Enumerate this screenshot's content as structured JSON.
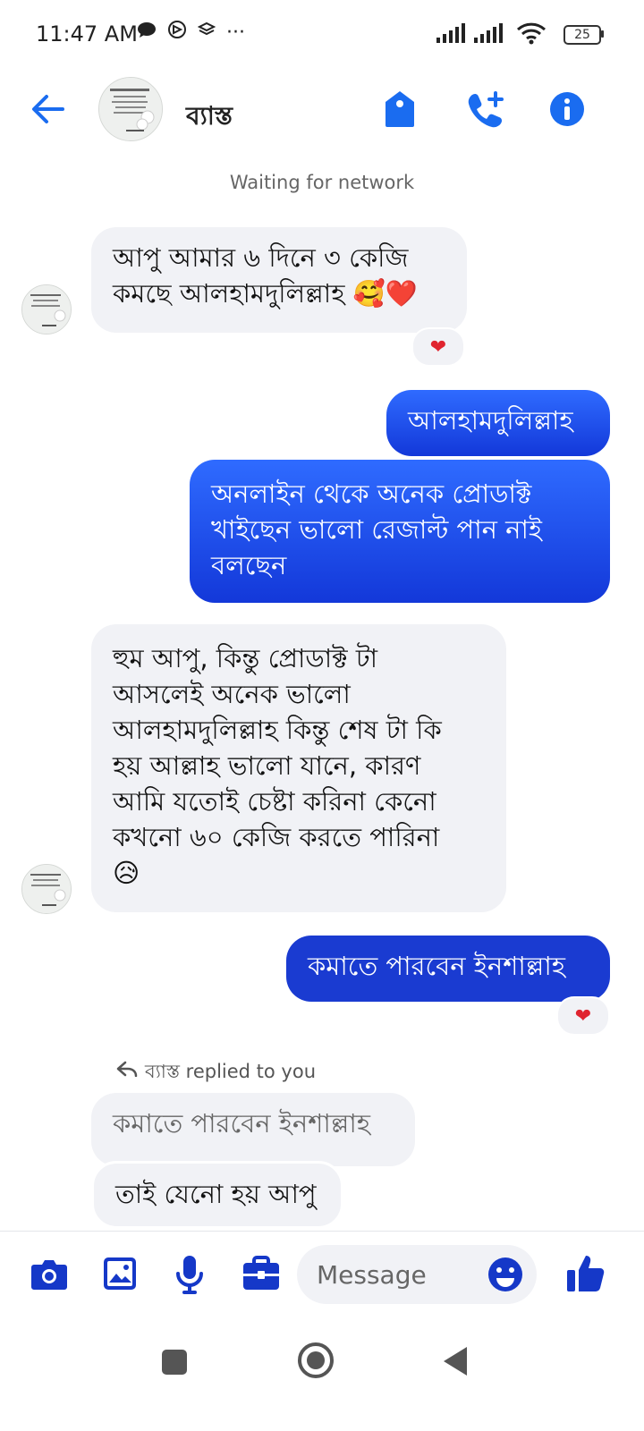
{
  "status_bar": {
    "time": "11:47 AM",
    "more": "···",
    "battery": "25"
  },
  "header": {
    "contact_name": "ব্যাস্ত",
    "network_status": "Waiting for network",
    "icons": [
      "back-arrow-icon",
      "tag-icon",
      "add-call-icon",
      "info-icon"
    ],
    "accent_color": "#1a6cf0"
  },
  "messages": [
    {
      "direction": "incoming",
      "text": "আপু আমার ৬ দিনে ৩ কেজি\nকমছে আলহামদুলিল্লাহ 🥰❤️",
      "reaction": "❤"
    },
    {
      "direction": "outgoing",
      "text": "আলহামদুলিল্লাহ"
    },
    {
      "direction": "outgoing",
      "text": "অনলাইন থেকে অনেক প্রোডাক্ট\nখাইছেন ভালো রেজাল্ট পান নাই\nবলছেন"
    },
    {
      "direction": "incoming",
      "text": "হুম আপু, কিন্তু প্রোডাক্ট টা\nআসলেই অনেক ভালো\nআলহামদুলিল্লাহ কিন্তু  শেষ টা কি\nহয় আল্লাহ ভালো যানে, কারণ\nআমি যতোই চেষ্টা করিনা কেনো\nকখনো ৬০ কেজি করতে পারিনা\n😥"
    },
    {
      "direction": "outgoing",
      "text": "কমাতে পারবেন ইনশাল্লাহ",
      "reaction": "❤"
    },
    {
      "direction": "incoming",
      "reply_label": "ব্যাস্ত replied to you",
      "quoted_text": "কমাতে পারবেন ইনশাল্লাহ",
      "text": "তাই যেনো হয় আপু"
    }
  ],
  "composer": {
    "placeholder": "Message",
    "icons": [
      "camera-icon",
      "gallery-icon",
      "microphone-icon",
      "briefcase-icon",
      "emoji-icon",
      "thumbs-up-icon"
    ]
  },
  "colors": {
    "outgoing_bubble": "#1a3bd1",
    "incoming_bubble": "#f1f2f6",
    "composer_icon": "#1538c8"
  }
}
